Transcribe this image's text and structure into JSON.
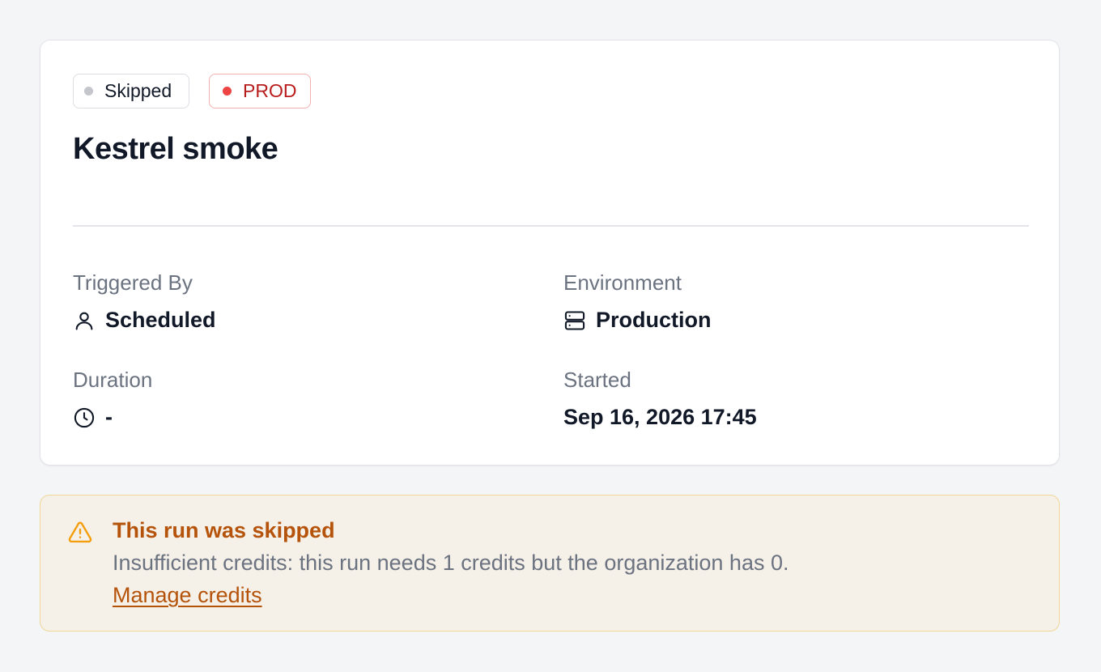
{
  "run": {
    "status_badge": "Skipped",
    "environment_badge": "PROD",
    "title": "Kestrel smoke"
  },
  "details": {
    "triggered_by": {
      "label": "Triggered By",
      "value": "Scheduled",
      "icon": "user-icon"
    },
    "environment": {
      "label": "Environment",
      "value": "Production",
      "icon": "server-icon"
    },
    "duration": {
      "label": "Duration",
      "value": "-",
      "icon": "clock-icon"
    },
    "started": {
      "label": "Started",
      "value": "Sep 16, 2026 17:45"
    }
  },
  "alert": {
    "icon": "warning-icon",
    "title": "This run was skipped",
    "message": "Insufficient credits: this run needs 1 credits but the organization has 0.",
    "link_label": "Manage credits"
  },
  "colors": {
    "status_dot": "#c4c6cc",
    "env_accent": "#b91c1c",
    "env_dot": "#ef4444",
    "warning_accent": "#b45309",
    "warning_background": "#f5f0e8"
  }
}
